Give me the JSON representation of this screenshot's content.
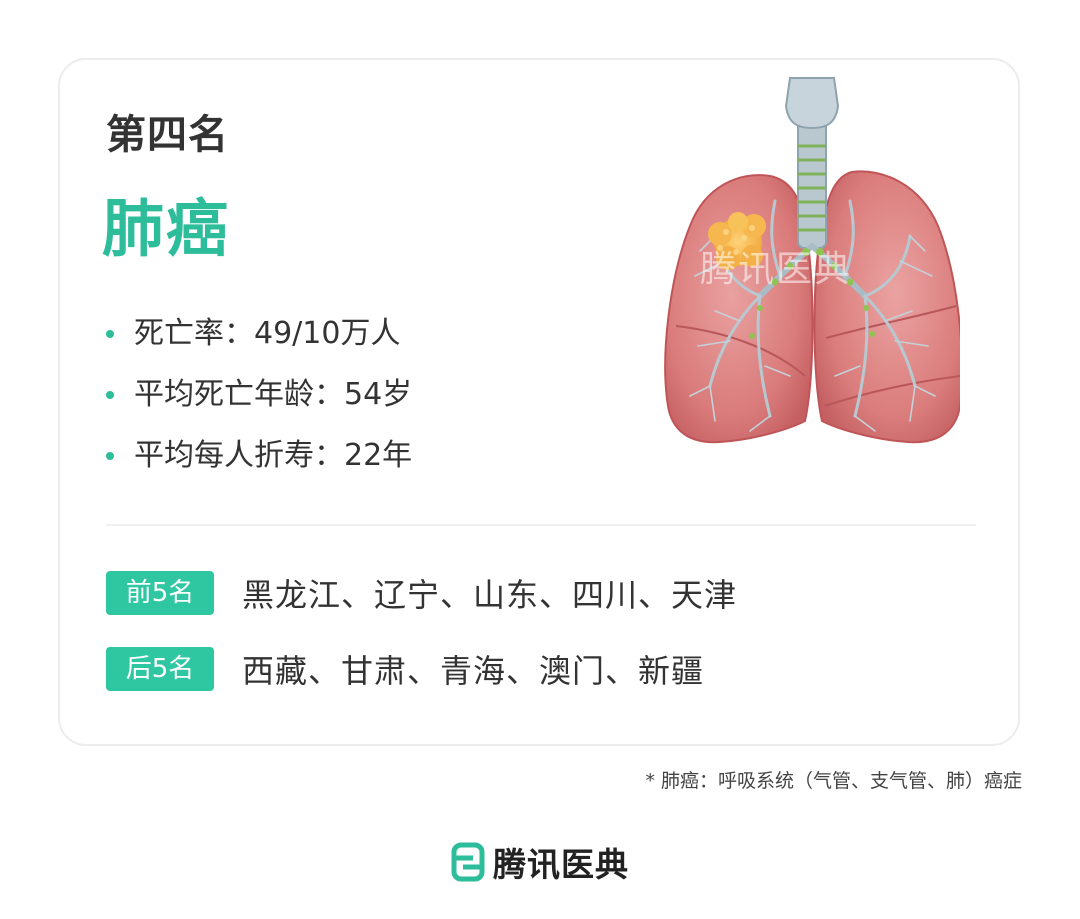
{
  "card": {
    "rank": "第四名",
    "disease": "肺癌",
    "stats": [
      "死亡率：49/10万人",
      "平均死亡年龄：54岁",
      "平均每人折寿：22年"
    ],
    "top5": {
      "tag": "前5名",
      "provinces": "黑龙江、辽宁、山东、四川、天津"
    },
    "bottom5": {
      "tag": "后5名",
      "provinces": "西藏、甘肃、青海、澳门、新疆"
    },
    "watermark": "腾讯医典"
  },
  "footnote": "* 肺癌：呼吸系统（气管、支气管、肺）癌症",
  "brand": {
    "name": "腾讯医典",
    "icon": "tencent-yidian-logo-icon",
    "color": "#2dbd9a"
  },
  "colors": {
    "accent": "#2dbd9a",
    "tag_bg": "#2fc7a1",
    "text": "#333333"
  }
}
